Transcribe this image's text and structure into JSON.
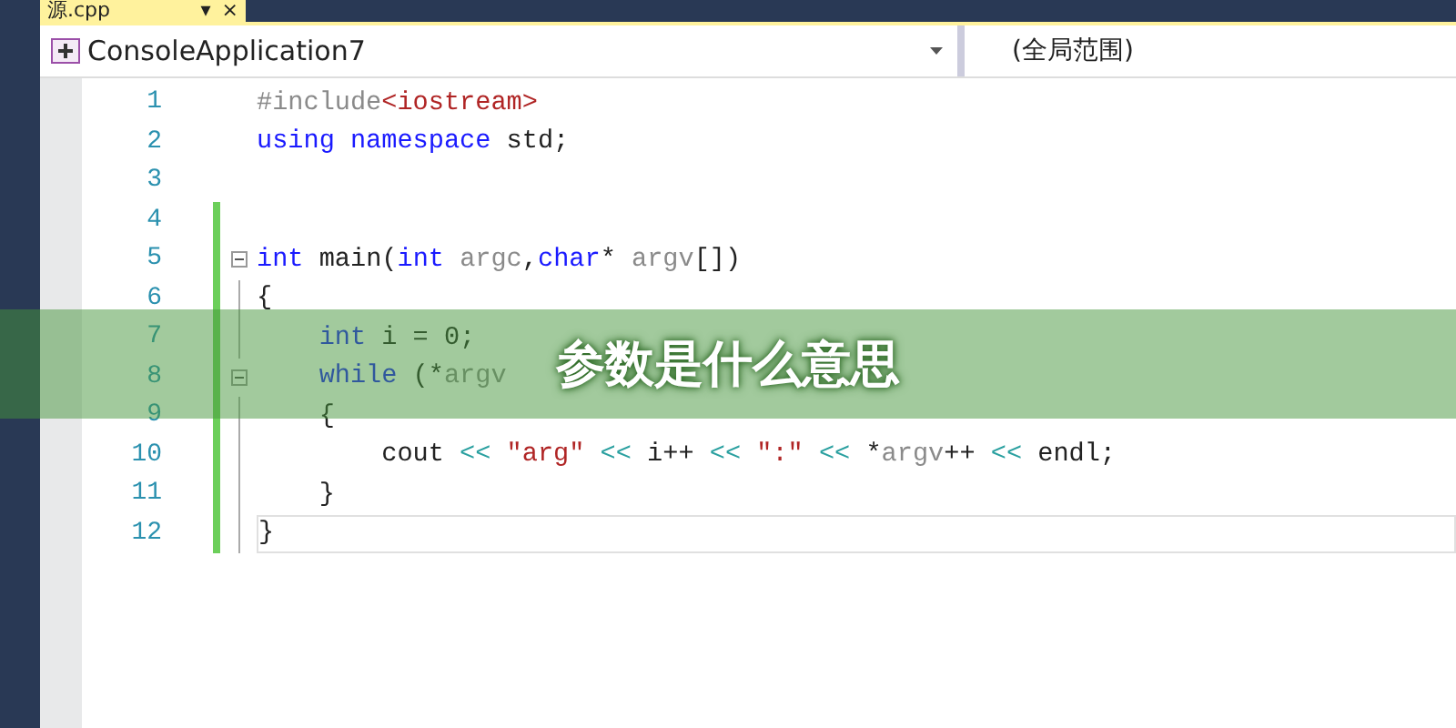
{
  "tab": {
    "title": "源.cpp",
    "pin": "▾",
    "close": "×"
  },
  "navbar": {
    "project": "ConsoleApplication7",
    "scope": "(全局范围)"
  },
  "lines": [
    {
      "number": "1",
      "changed": false,
      "fold": false,
      "current": false,
      "tokens": [
        {
          "kind": "pre",
          "text": "#include"
        },
        {
          "kind": "inc",
          "text": "<iostream>"
        }
      ]
    },
    {
      "number": "2",
      "changed": false,
      "fold": false,
      "current": false,
      "tokens": [
        {
          "kind": "kw",
          "text": "using namespace"
        },
        {
          "kind": "plain",
          "text": " std;"
        }
      ]
    },
    {
      "number": "3",
      "changed": false,
      "fold": false,
      "current": false
    },
    {
      "number": "4",
      "changed": true,
      "fold": false,
      "current": false
    },
    {
      "number": "5",
      "changed": true,
      "fold": true,
      "current": false,
      "tokens": [
        {
          "kind": "kw",
          "text": "int"
        },
        {
          "kind": "plain",
          "text": " main("
        },
        {
          "kind": "kw",
          "text": "int"
        },
        {
          "kind": "param",
          "text": " argc"
        },
        {
          "kind": "plain",
          "text": ","
        },
        {
          "kind": "kw",
          "text": "char"
        },
        {
          "kind": "plain",
          "text": "* "
        },
        {
          "kind": "param",
          "text": "argv"
        },
        {
          "kind": "plain",
          "text": "[])"
        }
      ]
    },
    {
      "number": "6",
      "changed": true,
      "fold": false,
      "current": false,
      "tokens": [
        {
          "kind": "plain",
          "text": "{"
        }
      ]
    },
    {
      "number": "7",
      "changed": true,
      "fold": false,
      "current": false,
      "tokens": [
        {
          "kind": "kw",
          "text": "    int"
        },
        {
          "kind": "plain",
          "text": " i = 0;"
        }
      ]
    },
    {
      "number": "8",
      "changed": true,
      "fold": true,
      "current": false,
      "tokens": [
        {
          "kind": "kw",
          "text": "    while"
        },
        {
          "kind": "plain",
          "text": " (*"
        },
        {
          "kind": "param",
          "text": "argv"
        }
      ]
    },
    {
      "number": "9",
      "changed": true,
      "fold": false,
      "current": false,
      "tokens": [
        {
          "kind": "plain",
          "text": "    {"
        }
      ]
    },
    {
      "number": "10",
      "changed": true,
      "fold": false,
      "current": false,
      "tokens": [
        {
          "kind": "plain",
          "text": "        cout "
        },
        {
          "kind": "op",
          "text": "<< "
        },
        {
          "kind": "str",
          "text": "\"arg\" "
        },
        {
          "kind": "op",
          "text": "<<"
        },
        {
          "kind": "plain",
          "text": " i++ "
        },
        {
          "kind": "op",
          "text": "<< "
        },
        {
          "kind": "str",
          "text": "\":\" "
        },
        {
          "kind": "op",
          "text": "<<"
        },
        {
          "kind": "plain",
          "text": " *"
        },
        {
          "kind": "param",
          "text": "argv"
        },
        {
          "kind": "plain",
          "text": "++ "
        },
        {
          "kind": "op",
          "text": "<<"
        },
        {
          "kind": "plain",
          "text": " endl;"
        }
      ]
    },
    {
      "number": "11",
      "changed": true,
      "fold": false,
      "current": false,
      "tokens": [
        {
          "kind": "plain",
          "text": "    }"
        }
      ]
    },
    {
      "number": "12",
      "changed": true,
      "fold": false,
      "current": true,
      "tokens": [
        {
          "kind": "plain",
          "text": "}"
        }
      ]
    }
  ],
  "banner": {
    "title": "参数是什么意思"
  }
}
